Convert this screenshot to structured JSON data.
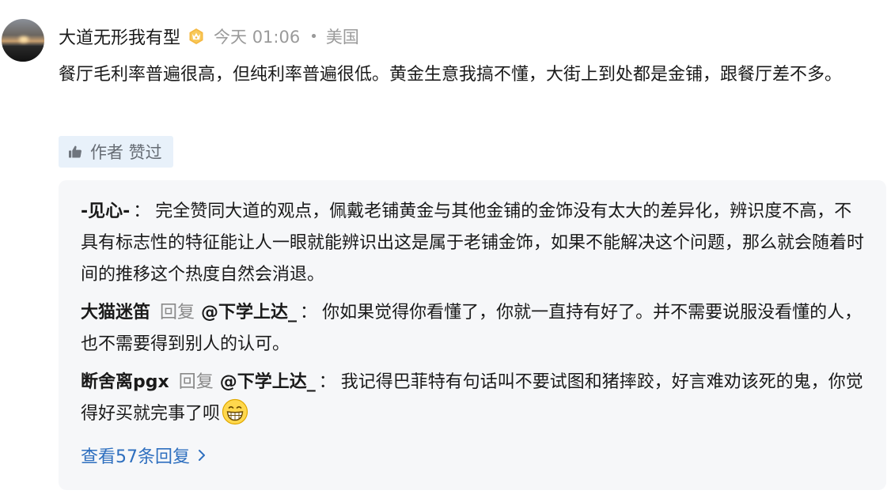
{
  "comment": {
    "author": "大道无形我有型",
    "time": "今天 01:06",
    "separator": "•",
    "location": "美国",
    "text": "餐厅毛利率普遍很高，但纯利率普遍很低。黄金生意我搞不懂，大街上到处都是金铺，跟餐厅差不多。",
    "liked_label": "作者 赞过",
    "badge_icon": "crown-level-badge-icon",
    "liked_icon": "thumbs-up-icon"
  },
  "replies": [
    {
      "user": "-见心-",
      "reply_to": "",
      "text": "完全赞同大道的观点，佩戴老铺黄金与其他金铺的金饰没有太大的差异化，辨识度不高，不具有标志性的特征能让人一眼就能辨识出这是属于老铺金饰，如果不能解决这个问题，那么就会随着时间的推移这个热度自然会消退。"
    },
    {
      "user": "大猫迷笛",
      "reply_word": "回复",
      "reply_to": "@下学上达_",
      "text": "你如果觉得你看懂了，你就一直持有好了。并不需要说服没看懂的人，也不需要得到别人的认可。"
    },
    {
      "user": "断舍离pgx",
      "reply_word": "回复",
      "reply_to": "@下学上达_",
      "text": "我记得巴菲特有句话叫不要试图和猪摔跤，好言难劝该死的鬼，你觉得好买就完事了呗",
      "emoji": "grinning-face-emoji"
    }
  ],
  "colon": "：",
  "view_more_label": "查看57条回复",
  "colors": {
    "link": "#2e6fbf",
    "muted": "#9a9a9a",
    "reply_bg": "#f6f7f9",
    "liked_bg": "#e8f1fa"
  }
}
